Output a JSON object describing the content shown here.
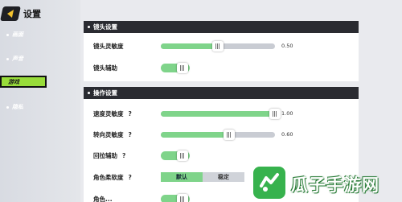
{
  "header": {
    "title": "设置"
  },
  "nav": {
    "items": [
      {
        "label": "画面",
        "active": false
      },
      {
        "label": "声音",
        "active": false
      },
      {
        "label": "游戏",
        "active": true
      },
      {
        "label": "隐私",
        "active": false
      }
    ]
  },
  "camera_section": {
    "title": "镜头设置",
    "sensitivity": {
      "label": "镜头灵敏度",
      "value_text": "0.50",
      "fraction": 0.5
    },
    "assist": {
      "label": "镜头辅助",
      "on": true
    }
  },
  "control_section": {
    "title": "操作设置",
    "speed_sensitivity": {
      "label": "速度灵敏度",
      "help": "?",
      "value_text": "1.00",
      "fraction": 1.0
    },
    "turn_sensitivity": {
      "label": "转向灵敏度",
      "help": "?",
      "value_text": "0.60",
      "fraction": 0.6
    },
    "pullback_assist": {
      "label": "回拉辅助",
      "help": "?",
      "on": true
    },
    "character_softness": {
      "label": "角色柔软度",
      "help": "?",
      "options": [
        "默认",
        "稳定"
      ],
      "selected": "默认"
    },
    "partial_row_label": "角色..."
  },
  "watermark": {
    "text": "瓜子手游网"
  },
  "colors": {
    "accent_green": "#7fd48a",
    "nav_active": "#98dc3a",
    "header_dark": "#2a2b31",
    "back_yellow": "#f2c12e",
    "watermark_green": "#37b24d"
  }
}
